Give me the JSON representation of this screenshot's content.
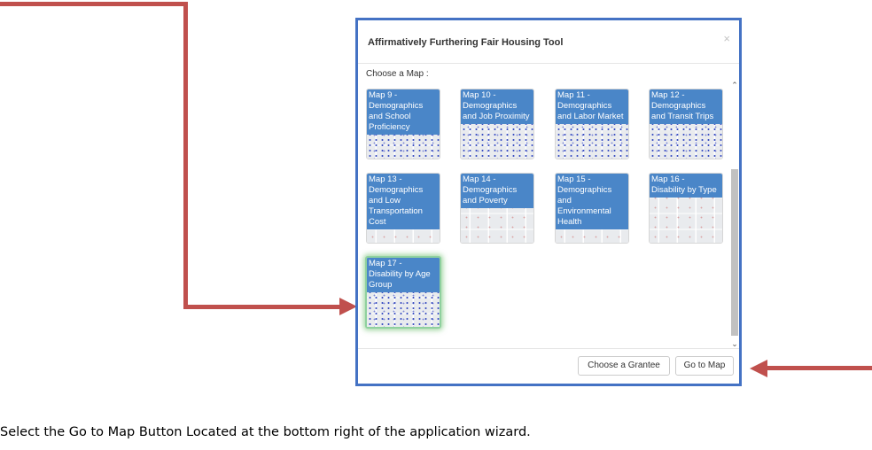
{
  "dialog": {
    "title": "Affirmatively Furthering Fair Housing Tool",
    "close_icon": "×",
    "choose_label": "Choose a Map :",
    "maps": [
      {
        "label": "Map 9 - Demographics and School Proficiency",
        "selected": false
      },
      {
        "label": "Map 10 - Demographics and Job Proximity",
        "selected": false
      },
      {
        "label": "Map 11 - Demographics and Labor Market",
        "selected": false
      },
      {
        "label": "Map 12 - Demographics and Transit Trips",
        "selected": false
      },
      {
        "label": "Map 13 - Demographics and Low Transportation Cost",
        "selected": false
      },
      {
        "label": "Map 14 - Demographics and Poverty",
        "selected": false
      },
      {
        "label": "Map 15 - Demographics and Environmental Health",
        "selected": false
      },
      {
        "label": "Map 16 - Disability by Type",
        "selected": false
      },
      {
        "label": "Map 17 - Disability by Age Group",
        "selected": true
      }
    ],
    "scroll_up_icon": "⌃",
    "scroll_down_icon": "⌄",
    "footer": {
      "choose_grantee_label": "Choose a Grantee",
      "go_to_map_label": "Go to Map"
    }
  },
  "caption": "Select the Go to Map Button Located at the bottom right of the application wizard.",
  "colors": {
    "dialog_border": "#4472c4",
    "card_label_bg": "#4a86c8",
    "annotation_arrow": "#c0504d",
    "selected_glow": "#5cb85c"
  }
}
